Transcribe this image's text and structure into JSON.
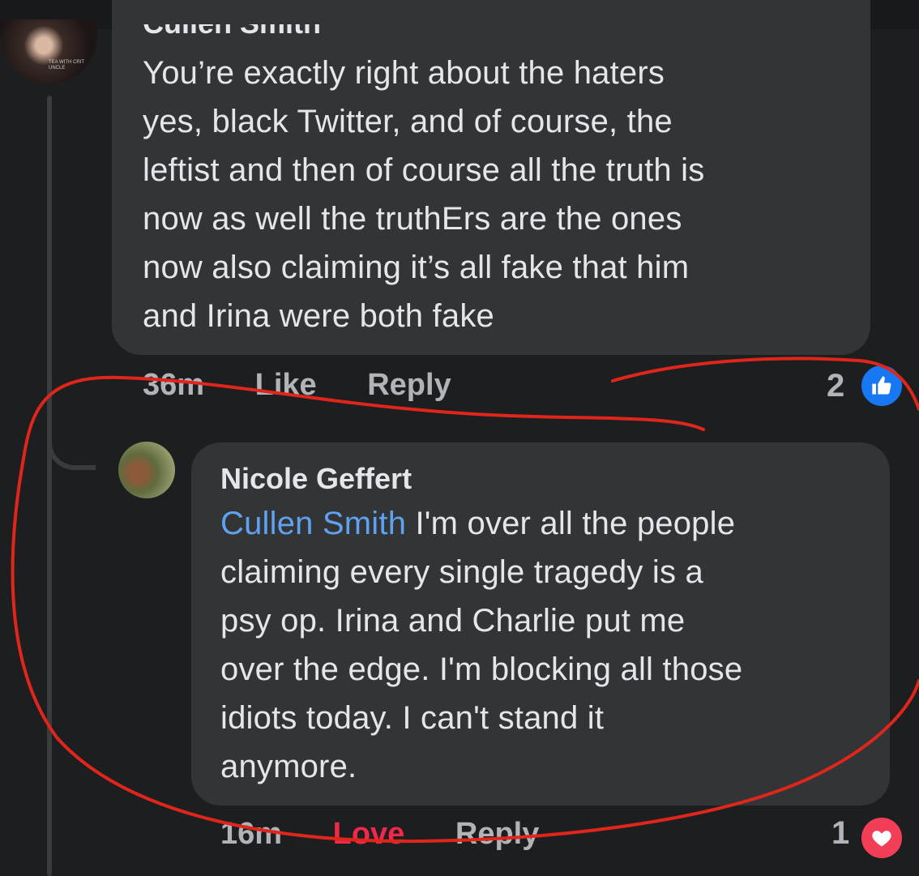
{
  "comments": [
    {
      "author": "Cullen Smith",
      "avatar_text": "TEA WITH CRIT UNCLE",
      "lines": [
        "You’re exactly right about the haters",
        "yes, black Twitter, and of course, the",
        "leftist and then of course all the truth is",
        "now as well the truthErs are the ones",
        "now also claiming it’s all fake that him",
        "and Irina were both fake"
      ],
      "time": "36m",
      "actions": [
        "Like",
        "Reply"
      ],
      "reaction_count": "2",
      "reaction_icon": "like-icon"
    },
    {
      "author": "Nicole Geffert",
      "mention": "Cullen Smith",
      "first_line_rest": " I'm over all the people",
      "lines": [
        "claiming every single tragedy is a",
        "psy op. Irina and Charlie put me",
        "over the edge. I'm blocking all those",
        "idiots today. I can't stand it",
        "anymore."
      ],
      "time": "16m",
      "actions": [
        "Love",
        "Reply"
      ],
      "reaction_count": "1",
      "reaction_icon": "heart-icon"
    }
  ],
  "colors": {
    "background": "#1d1e20",
    "bubble": "#333436",
    "mention": "#5ea2f0",
    "annotation": "#e0261b",
    "love": "#f02849",
    "like_badge": "#1877f2"
  }
}
